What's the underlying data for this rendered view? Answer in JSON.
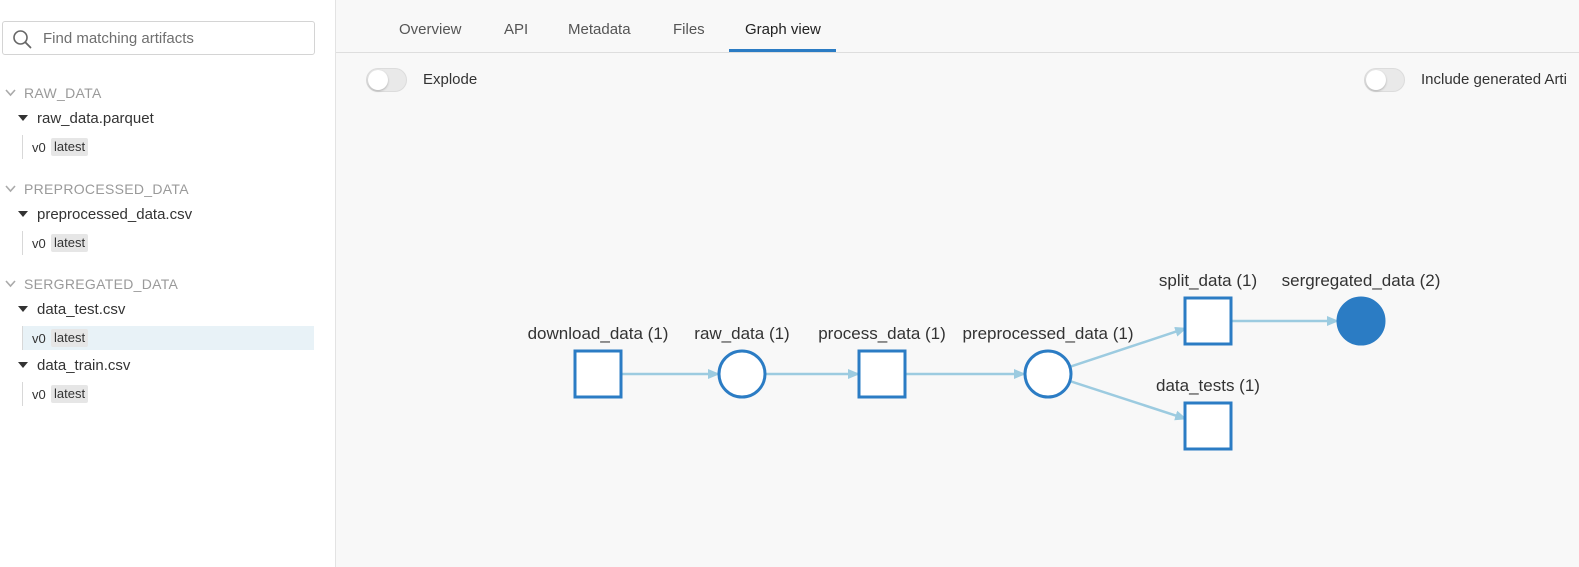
{
  "search": {
    "placeholder": "Find matching artifacts"
  },
  "sidebar": {
    "groups": [
      {
        "name": "RAW_DATA",
        "files": [
          {
            "name": "raw_data.parquet",
            "versions": [
              {
                "version": "v0",
                "alias": "latest"
              }
            ]
          }
        ]
      },
      {
        "name": "PREPROCESSED_DATA",
        "files": [
          {
            "name": "preprocessed_data.csv",
            "versions": [
              {
                "version": "v0",
                "alias": "latest"
              }
            ]
          }
        ]
      },
      {
        "name": "SERGREGATED_DATA",
        "files": [
          {
            "name": "data_test.csv",
            "versions": [
              {
                "version": "v0",
                "alias": "latest",
                "selected": true
              }
            ]
          },
          {
            "name": "data_train.csv",
            "versions": [
              {
                "version": "v0",
                "alias": "latest"
              }
            ]
          }
        ]
      }
    ]
  },
  "tabs": [
    {
      "label": "Overview"
    },
    {
      "label": "API"
    },
    {
      "label": "Metadata"
    },
    {
      "label": "Files"
    },
    {
      "label": "Graph view",
      "active": true
    }
  ],
  "toggles": {
    "explode": {
      "label": "Explode",
      "on": false
    },
    "include_generated": {
      "label": "Include generated Arti",
      "on": false
    }
  },
  "graph": {
    "nodes": [
      {
        "id": "download_data",
        "label": "download_data (1)",
        "kind": "run"
      },
      {
        "id": "raw_data",
        "label": "raw_data (1)",
        "kind": "artifact"
      },
      {
        "id": "process_data",
        "label": "process_data (1)",
        "kind": "run"
      },
      {
        "id": "preprocessed_data",
        "label": "preprocessed_data (1)",
        "kind": "artifact"
      },
      {
        "id": "split_data",
        "label": "split_data (1)",
        "kind": "run"
      },
      {
        "id": "data_tests",
        "label": "data_tests (1)",
        "kind": "run"
      },
      {
        "id": "sergregated_data",
        "label": "sergregated_data (2)",
        "kind": "artifact",
        "selected": true
      }
    ],
    "edges": [
      [
        "download_data",
        "raw_data"
      ],
      [
        "raw_data",
        "process_data"
      ],
      [
        "process_data",
        "preprocessed_data"
      ],
      [
        "preprocessed_data",
        "split_data"
      ],
      [
        "preprocessed_data",
        "data_tests"
      ],
      [
        "split_data",
        "sergregated_data"
      ]
    ],
    "colors": {
      "node_stroke": "#2b7cc4",
      "node_fill": "#ffffff",
      "selected_fill": "#2b7cc4",
      "edge": "#9ccbe0"
    }
  }
}
